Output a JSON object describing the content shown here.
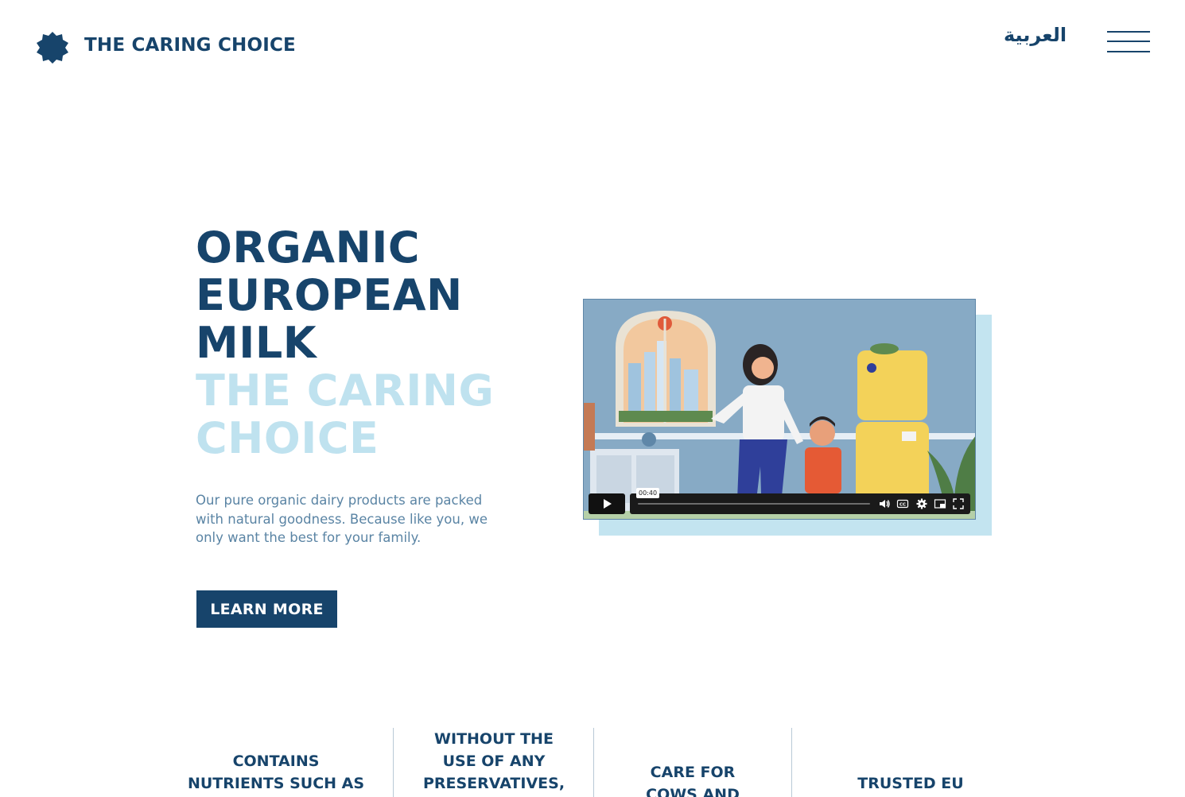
{
  "header": {
    "brand": "THE CARING CHOICE",
    "logo_icon": "badge-star-icon",
    "language_link": "العربية",
    "menu_icon": "hamburger-menu-icon"
  },
  "hero": {
    "title_lines": [
      "ORGANIC",
      "EUROPEAN",
      "MILK"
    ],
    "subtitle_lines": [
      "THE CARING",
      "CHOICE"
    ],
    "description": "Our pure organic dairy products are packed with natural goodness. Because like you, we only want the best for your family.",
    "cta_label": "LEARN MORE"
  },
  "video": {
    "time_tooltip": "00:40",
    "progress": 0.0,
    "controls": [
      "play-icon",
      "volume-icon",
      "captions-icon",
      "settings-icon",
      "picture-in-picture-icon",
      "fullscreen-icon"
    ]
  },
  "features": [
    {
      "lines": [
        "CONTAINS",
        "NUTRIENTS SUCH AS"
      ]
    },
    {
      "lines": [
        "WITHOUT THE",
        "USE OF ANY",
        "PRESERVATIVES,"
      ]
    },
    {
      "lines": [
        "CARE FOR",
        "COWS AND"
      ]
    },
    {
      "lines": [
        "TRUSTED EU"
      ]
    }
  ],
  "colors": {
    "primary": "#17446b",
    "accent_light": "#bfe2ef",
    "body_text": "#5a84a4",
    "video_shadow": "#c3e4f0"
  }
}
